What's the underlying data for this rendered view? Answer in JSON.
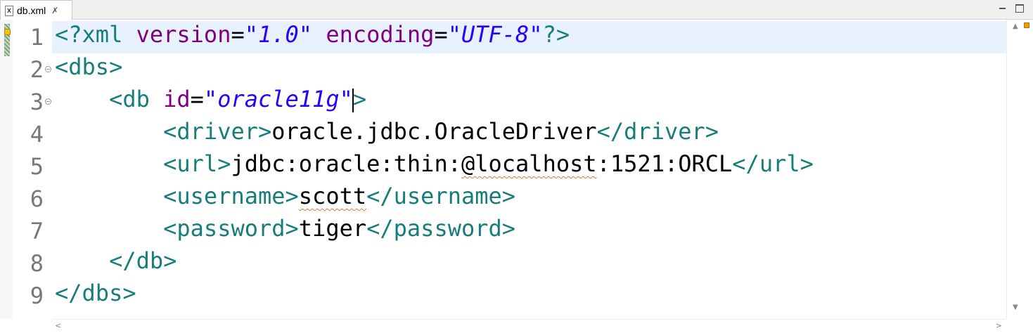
{
  "tab": {
    "file_name": "db.xml",
    "file_icon": "X",
    "close_glyph": "✗"
  },
  "editor": {
    "lines": [
      {
        "number": "1",
        "tokens": [
          {
            "k": "t",
            "s": "<?xml "
          },
          {
            "k": "a",
            "s": "version"
          },
          {
            "k": "x",
            "s": "="
          },
          {
            "k": "v",
            "s": "\"1.0\""
          },
          {
            "k": "x",
            "s": " "
          },
          {
            "k": "a",
            "s": "encoding"
          },
          {
            "k": "x",
            "s": "="
          },
          {
            "k": "v",
            "s": "\"UTF-8\""
          },
          {
            "k": "t",
            "s": "?>"
          }
        ]
      },
      {
        "number": "2",
        "tokens": [
          {
            "k": "t",
            "s": "<dbs>"
          }
        ]
      },
      {
        "number": "3",
        "tokens": [
          {
            "k": "x",
            "s": "    "
          },
          {
            "k": "t",
            "s": "<db "
          },
          {
            "k": "a",
            "s": "id"
          },
          {
            "k": "x",
            "s": "="
          },
          {
            "k": "v",
            "s": "\"oracle11g\""
          },
          {
            "k": "t",
            "s": ">"
          }
        ]
      },
      {
        "number": "4",
        "tokens": [
          {
            "k": "x",
            "s": "        "
          },
          {
            "k": "t",
            "s": "<driver>"
          },
          {
            "k": "x",
            "s": "oracle.jdbc.OracleDriver"
          },
          {
            "k": "t",
            "s": "</driver>"
          }
        ]
      },
      {
        "number": "5",
        "tokens": [
          {
            "k": "x",
            "s": "        "
          },
          {
            "k": "t",
            "s": "<url>"
          },
          {
            "k": "x",
            "s": "jdbc:oracle:thin:"
          },
          {
            "k": "xs",
            "s": "@localhost"
          },
          {
            "k": "x",
            "s": ":1521:ORCL"
          },
          {
            "k": "t",
            "s": "</url>"
          }
        ]
      },
      {
        "number": "6",
        "tokens": [
          {
            "k": "x",
            "s": "        "
          },
          {
            "k": "t",
            "s": "<username>"
          },
          {
            "k": "xs",
            "s": "scott"
          },
          {
            "k": "t",
            "s": "</username>"
          }
        ]
      },
      {
        "number": "7",
        "tokens": [
          {
            "k": "x",
            "s": "        "
          },
          {
            "k": "t",
            "s": "<password>"
          },
          {
            "k": "x",
            "s": "tiger"
          },
          {
            "k": "t",
            "s": "</password>"
          }
        ]
      },
      {
        "number": "8",
        "tokens": [
          {
            "k": "x",
            "s": "    "
          },
          {
            "k": "t",
            "s": "</db>"
          }
        ]
      },
      {
        "number": "9",
        "tokens": [
          {
            "k": "t",
            "s": "</dbs>"
          }
        ]
      }
    ],
    "current_line": "1",
    "foldable_lines": [
      "2",
      "3"
    ],
    "fold_glyph": "−"
  },
  "scroll": {
    "up_glyph": "▲",
    "down_glyph": "▼",
    "left_glyph": "<",
    "right_glyph": ">"
  },
  "colors": {
    "tag": "#177d7b",
    "attribute": "#7f007f",
    "value": "#2a00ff",
    "text": "#000000",
    "current_line": "#e8f2fe"
  }
}
